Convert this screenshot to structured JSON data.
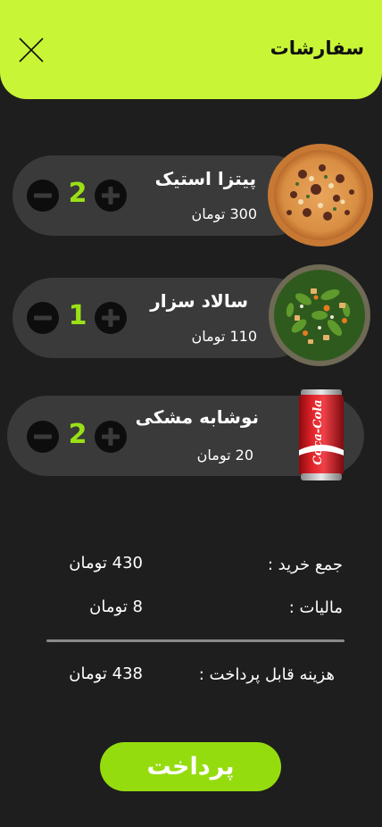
{
  "header": {
    "title": "سفارشات"
  },
  "items": [
    {
      "name": "پیتزا استیک",
      "price": "300 تومان",
      "quantity": "2"
    },
    {
      "name": "سالاد سزار",
      "price": "110 تومان",
      "quantity": "1"
    },
    {
      "name": "نوشابه مشکی",
      "price": "20 تومان",
      "quantity": "2"
    }
  ],
  "summary": {
    "subtotal_label": "جمع خرید :",
    "subtotal_value": "430 تومان",
    "tax_label": "مالیات :",
    "tax_value": "8 تومان",
    "total_label": "هزینه قابل پرداخت :",
    "total_value": "438 تومان"
  },
  "pay_button": {
    "label": "پرداخت"
  },
  "icons": {
    "close": "close-icon",
    "minus": "minus-circle-icon",
    "plus": "plus-circle-icon"
  },
  "colors": {
    "header": "#c8f536",
    "accent": "#95dc0f",
    "quantity": "#9be016",
    "background": "#1e1e1e",
    "card": "#3a3a3a"
  }
}
